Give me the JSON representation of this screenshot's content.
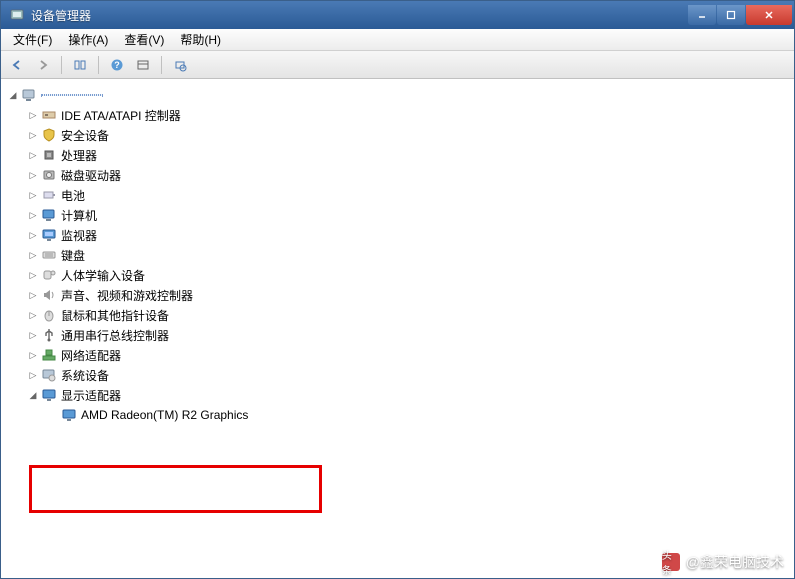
{
  "window": {
    "title": "设备管理器"
  },
  "menu": {
    "file": "文件(F)",
    "action": "操作(A)",
    "view": "查看(V)",
    "help": "帮助(H)"
  },
  "tree": {
    "root": "",
    "items": [
      {
        "label": "IDE ATA/ATAPI 控制器",
        "icon": "ide"
      },
      {
        "label": "安全设备",
        "icon": "security"
      },
      {
        "label": "处理器",
        "icon": "cpu"
      },
      {
        "label": "磁盘驱动器",
        "icon": "disk"
      },
      {
        "label": "电池",
        "icon": "battery"
      },
      {
        "label": "计算机",
        "icon": "computer"
      },
      {
        "label": "监视器",
        "icon": "monitor"
      },
      {
        "label": "键盘",
        "icon": "keyboard"
      },
      {
        "label": "人体学输入设备",
        "icon": "hid"
      },
      {
        "label": "声音、视频和游戏控制器",
        "icon": "sound"
      },
      {
        "label": "鼠标和其他指针设备",
        "icon": "mouse"
      },
      {
        "label": "通用串行总线控制器",
        "icon": "usb"
      },
      {
        "label": "网络适配器",
        "icon": "network"
      },
      {
        "label": "系统设备",
        "icon": "system"
      }
    ],
    "display": {
      "label": "显示适配器",
      "child": "AMD Radeon(TM) R2 Graphics"
    }
  },
  "watermark": {
    "prefix": "头条",
    "text": "@鑫荣电脑技术"
  }
}
